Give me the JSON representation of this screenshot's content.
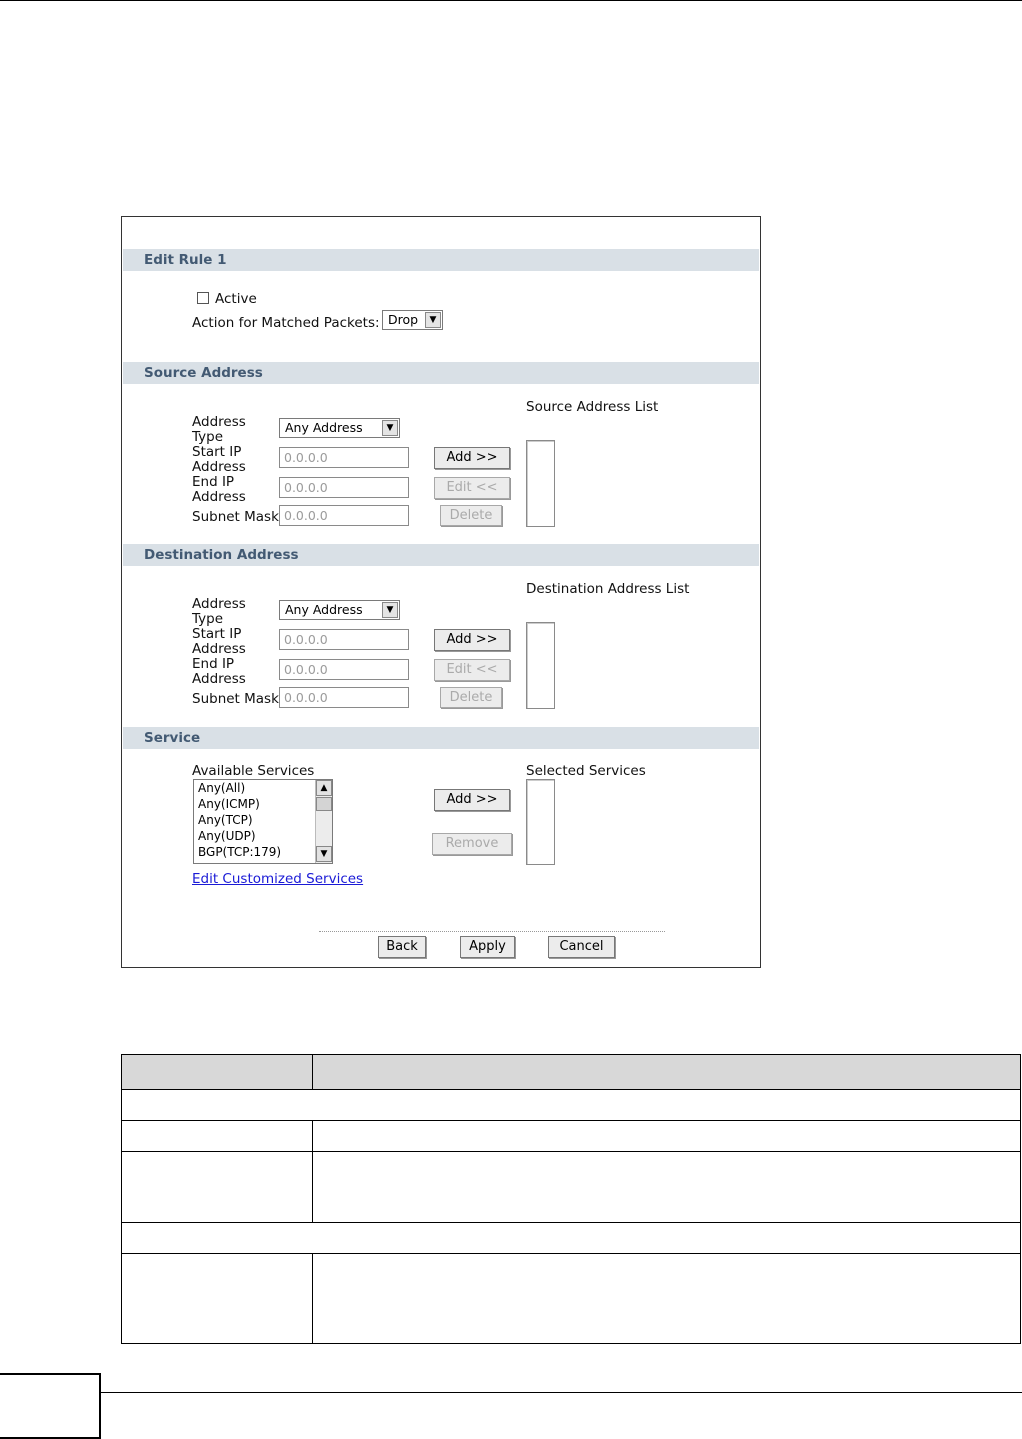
{
  "rule": {
    "title": "Edit Rule 1",
    "active_label": "Active",
    "active_checked": false,
    "action_label": "Action for Matched Packets:",
    "action_value": "Drop"
  },
  "source": {
    "title": "Source Address",
    "list_label": "Source Address List",
    "address_type_label": "Address Type",
    "address_type_value": "Any Address",
    "start_ip_label": "Start IP Address",
    "start_ip_value": "0.0.0.0",
    "end_ip_label": "End IP Address",
    "end_ip_value": "0.0.0.0",
    "subnet_label": "Subnet Mask",
    "subnet_value": "0.0.0.0",
    "add_label": "Add >>",
    "edit_label": "Edit <<",
    "delete_label": "Delete"
  },
  "destination": {
    "title": "Destination Address",
    "list_label": "Destination Address List",
    "address_type_label": "Address Type",
    "address_type_value": "Any Address",
    "start_ip_label": "Start IP Address",
    "start_ip_value": "0.0.0.0",
    "end_ip_label": "End IP Address",
    "end_ip_value": "0.0.0.0",
    "subnet_label": "Subnet Mask",
    "subnet_value": "0.0.0.0",
    "add_label": "Add >>",
    "edit_label": "Edit <<",
    "delete_label": "Delete"
  },
  "service": {
    "title": "Service",
    "available_label": "Available Services",
    "selected_label": "Selected Services",
    "available_items": [
      "Any(All)",
      "Any(ICMP)",
      "Any(TCP)",
      "Any(UDP)",
      "BGP(TCP:179)"
    ],
    "add_label": "Add >>",
    "remove_label": "Remove",
    "edit_link": "Edit Customized Services"
  },
  "footer_buttons": {
    "back": "Back",
    "apply": "Apply",
    "cancel": "Cancel"
  }
}
